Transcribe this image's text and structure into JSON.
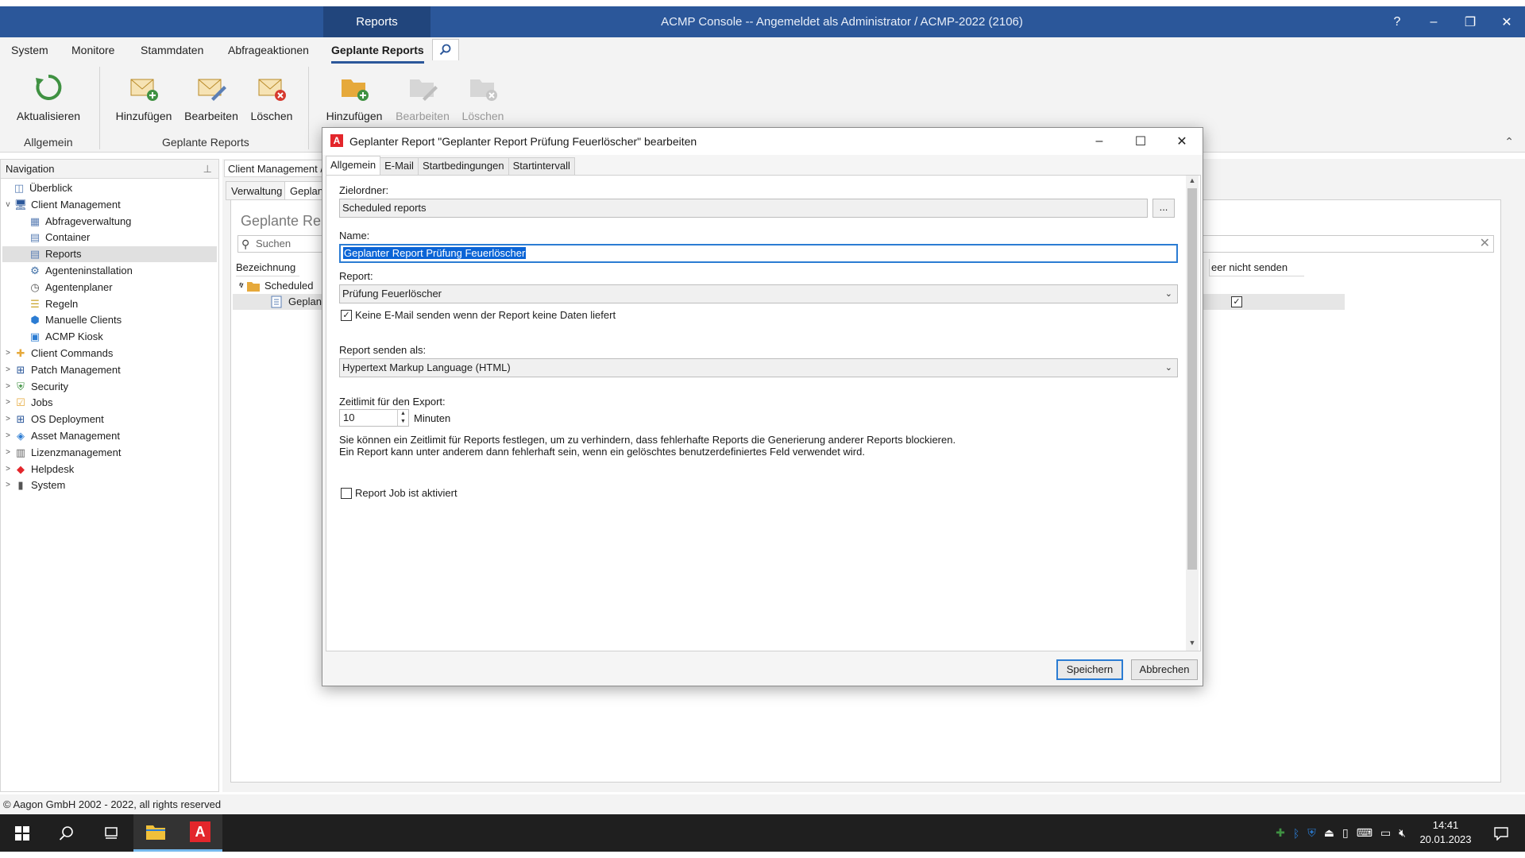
{
  "titlebar": {
    "context_tab": "Reports",
    "title": "ACMP Console -- Angemeldet als Administrator / ACMP-2022 (2106)",
    "help": "?",
    "minimize": "–",
    "restore": "❐",
    "close": "✕"
  },
  "menu": {
    "items": [
      "System",
      "Monitore",
      "Stammdaten",
      "Abfrageaktionen",
      "Geplante Reports"
    ],
    "active": "Geplante Reports"
  },
  "ribbon": {
    "refresh": "Aktualisieren",
    "group_general": "Allgemein",
    "add": "Hinzufügen",
    "edit": "Bearbeiten",
    "delete": "Löschen",
    "group_reports": "Geplante Reports",
    "add2": "Hinzufügen",
    "edit2": "Bearbeiten",
    "delete2": "Löschen"
  },
  "nav": {
    "header": "Navigation",
    "items": [
      {
        "label": "Überblick",
        "level": 1,
        "expander": ""
      },
      {
        "label": "Client Management",
        "level": 0,
        "expander": "v"
      },
      {
        "label": "Abfrageverwaltung",
        "level": 2,
        "expander": ""
      },
      {
        "label": "Container",
        "level": 2,
        "expander": ""
      },
      {
        "label": "Reports",
        "level": 2,
        "expander": "",
        "selected": true
      },
      {
        "label": "Agenteninstallation",
        "level": 2,
        "expander": ""
      },
      {
        "label": "Agentenplaner",
        "level": 2,
        "expander": ""
      },
      {
        "label": "Regeln",
        "level": 2,
        "expander": ""
      },
      {
        "label": "Manuelle Clients",
        "level": 2,
        "expander": ""
      },
      {
        "label": "ACMP Kiosk",
        "level": 2,
        "expander": ""
      },
      {
        "label": "Client Commands",
        "level": 0,
        "expander": ">"
      },
      {
        "label": "Patch Management",
        "level": 0,
        "expander": ">"
      },
      {
        "label": "Security",
        "level": 0,
        "expander": ">"
      },
      {
        "label": "Jobs",
        "level": 0,
        "expander": ">"
      },
      {
        "label": "OS Deployment",
        "level": 0,
        "expander": ">"
      },
      {
        "label": "Asset Management",
        "level": 0,
        "expander": ">"
      },
      {
        "label": "Lizenzmanagement",
        "level": 0,
        "expander": ">"
      },
      {
        "label": "Helpdesk",
        "level": 0,
        "expander": ">"
      },
      {
        "label": "System",
        "level": 0,
        "expander": ">"
      }
    ]
  },
  "main": {
    "breadcrumb": "Client Management / R",
    "tabs": [
      "Verwaltung",
      "Geplant"
    ],
    "panel_title": "Geplante Repo",
    "search_placeholder": "Suchen",
    "col_name": "Bezeichnung",
    "col_right": "eer nicht senden",
    "row_folder": "Scheduled",
    "row_item": "Geplant"
  },
  "dialog": {
    "title": "Geplanter Report \"Geplanter Report Prüfung Feuerlöscher\" bearbeiten",
    "tabs": [
      "Allgemein",
      "E-Mail",
      "Startbedingungen",
      "Startintervall"
    ],
    "active_tab": "Allgemein",
    "target_folder_label": "Zielordner:",
    "target_folder_value": "Scheduled reports",
    "browse": "...",
    "name_label": "Name:",
    "name_value": "Geplanter Report Prüfung Feuerlöscher",
    "report_label": "Report:",
    "report_value": "Prüfung Feuerlöscher",
    "no_mail_checkbox": "Keine E-Mail senden wenn der Report keine Daten liefert",
    "no_mail_checked": true,
    "send_as_label": "Report senden als:",
    "send_as_value": "Hypertext Markup Language (HTML)",
    "timeout_label": "Zeitlimit für den Export:",
    "timeout_value": "10",
    "timeout_unit": "Minuten",
    "info_line1": "Sie können ein Zeitlimit für Reports festlegen, um zu verhindern, dass fehlerhafte Reports die Generierung anderer Reports blockieren.",
    "info_line2": "Ein Report kann unter anderem dann fehlerhaft sein, wenn ein gelöschtes benutzerdefiniertes Feld verwendet wird.",
    "job_active_checkbox": "Report Job ist aktiviert",
    "job_active_checked": false,
    "save": "Speichern",
    "cancel": "Abbrechen"
  },
  "statusbar": {
    "copyright": "© Aagon GmbH 2002 - 2022, all rights reserved"
  },
  "taskbar": {
    "time": "14:41",
    "date": "20.01.2023"
  },
  "colors": {
    "titlebar": "#2b579a",
    "accent": "#2b7cd3",
    "brand_red": "#e3262b"
  }
}
